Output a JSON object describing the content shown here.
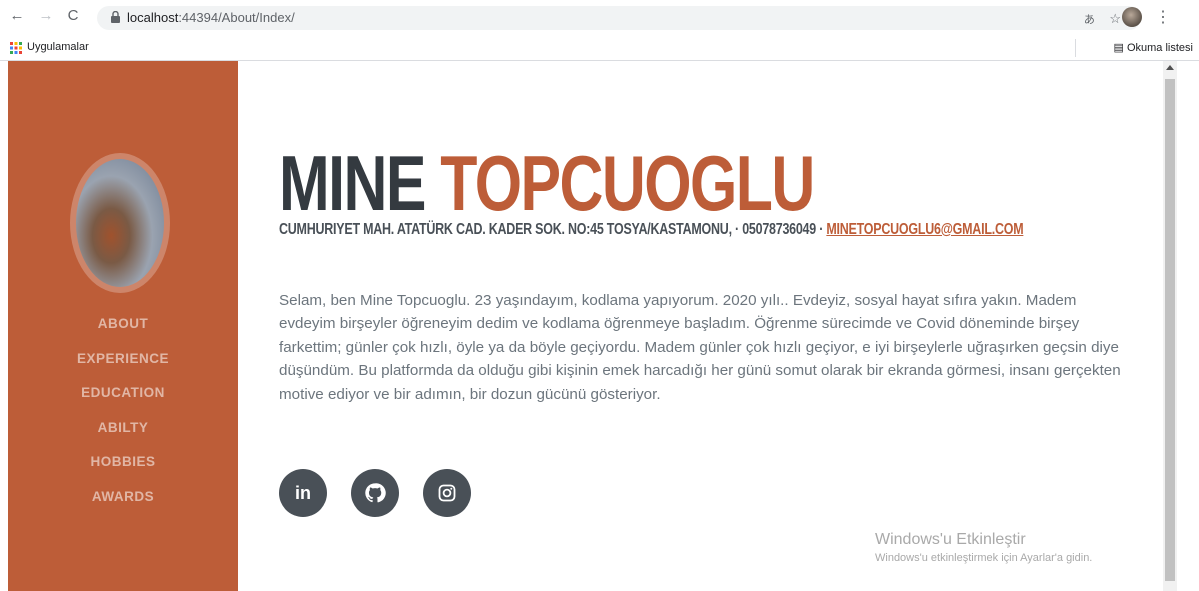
{
  "browser": {
    "url_host": "localhost",
    "url_rest": ":44394/About/Index/",
    "bookmark_apps": "Uygulamalar",
    "reading_list": "Okuma listesi"
  },
  "sidebar": {
    "nav": [
      "ABOUT",
      "EXPERIENCE",
      "EDUCATION",
      "ABILTY",
      "HOBBIES",
      "AWARDS"
    ],
    "bg_color": "#bd5d38"
  },
  "about": {
    "first_name": "MINE",
    "last_name": "TOPCUOGLU",
    "address": "CUMHURIYET MAH. ATATÜRK CAD. KADER SOK. NO:45 TOSYA/KASTAMONU, · 05078736049 · ",
    "email": "MINETOPCUOGLU6@GMAIL.COM",
    "bio": "Selam, ben Mine Topcuoglu. 23 yaşındayım, kodlama yapıyorum. 2020 yılı.. Evdeyiz, sosyal hayat sıfıra yakın. Madem evdeyim birşeyler öğreneyim dedim ve kodlama öğrenmeye başladım. Öğrenme sürecimde ve Covid döneminde birşey farkettim; günler çok hızlı, öyle ya da böyle geçiyordu. Madem günler çok hızlı geçiyor, e iyi birşeylerle uğraşırken geçsin diye düşündüm. Bu platformda da olduğu gibi kişinin emek harcadığı her günü somut olarak bir ekranda görmesi, insanı gerçekten motive ediyor ve bir adımın, bir dozun gücünü gösteriyor."
  },
  "socials": [
    "linkedin-icon",
    "github-icon",
    "instagram-icon"
  ],
  "watermark": {
    "title": "Windows'u Etkinleştir",
    "subtitle": "Windows'u etkinleştirmek için Ayarlar'a gidin."
  }
}
